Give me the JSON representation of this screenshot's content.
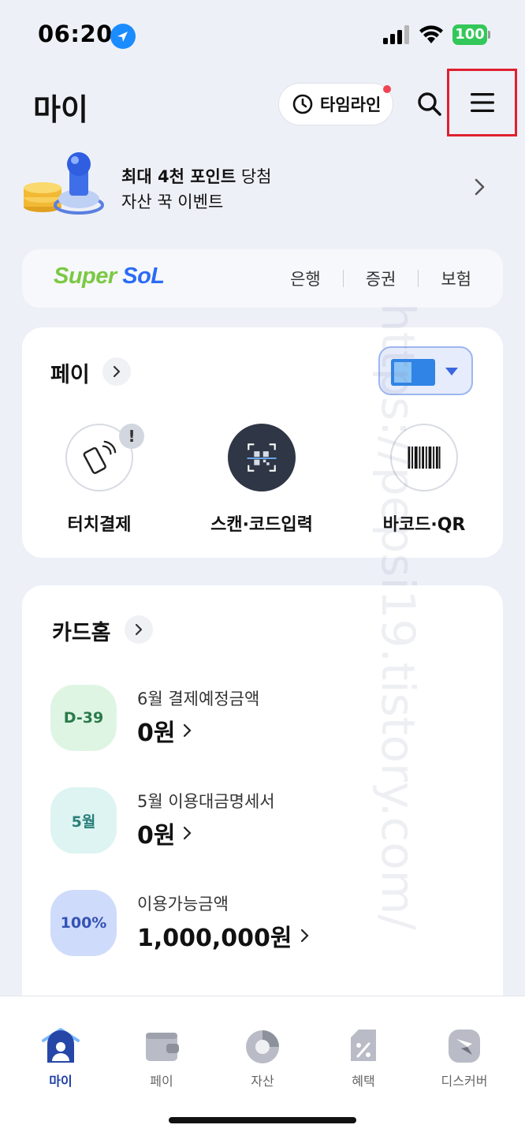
{
  "status_bar": {
    "time": "06:20",
    "battery": "100"
  },
  "header": {
    "title": "마이",
    "timeline_label": "타임라인"
  },
  "event_banner": {
    "line1_bold": "최대 4천 포인트",
    "line1_rest": " 당첨",
    "line2": "자산 꾹 이벤트"
  },
  "supersol": {
    "logo_super": "Super",
    "logo_sol": "SoL",
    "links": [
      "은행",
      "증권",
      "보험"
    ]
  },
  "pay": {
    "title": "페이",
    "items": [
      {
        "label": "터치결제",
        "icon": "touch-pay-icon"
      },
      {
        "label": "스캔·코드입력",
        "icon": "qr-scan-icon"
      },
      {
        "label": "바코드·QR",
        "icon": "barcode-icon"
      }
    ]
  },
  "card_home": {
    "title": "카드홈",
    "rows": [
      {
        "badge": "D-39",
        "label": "6월 결제예정금액",
        "value": "0원"
      },
      {
        "badge": "5월",
        "label": "5월 이용대금명세서",
        "value": "0원"
      },
      {
        "badge": "100%",
        "label": "이용가능금액",
        "value": "1,000,000원"
      }
    ]
  },
  "bottom_nav": {
    "items": [
      {
        "label": "마이",
        "icon": "home-person-icon"
      },
      {
        "label": "페이",
        "icon": "wallet-icon"
      },
      {
        "label": "자산",
        "icon": "pie-chart-icon"
      },
      {
        "label": "혜택",
        "icon": "coupon-tag-icon"
      },
      {
        "label": "디스커버",
        "icon": "compass-icon"
      }
    ]
  },
  "watermark": "https://pepsi19.tistory.com/",
  "colors": {
    "background": "#eef0f8",
    "accent": "#1f3fa8",
    "highlight_box": "#e0202e",
    "battery": "#34c759"
  }
}
